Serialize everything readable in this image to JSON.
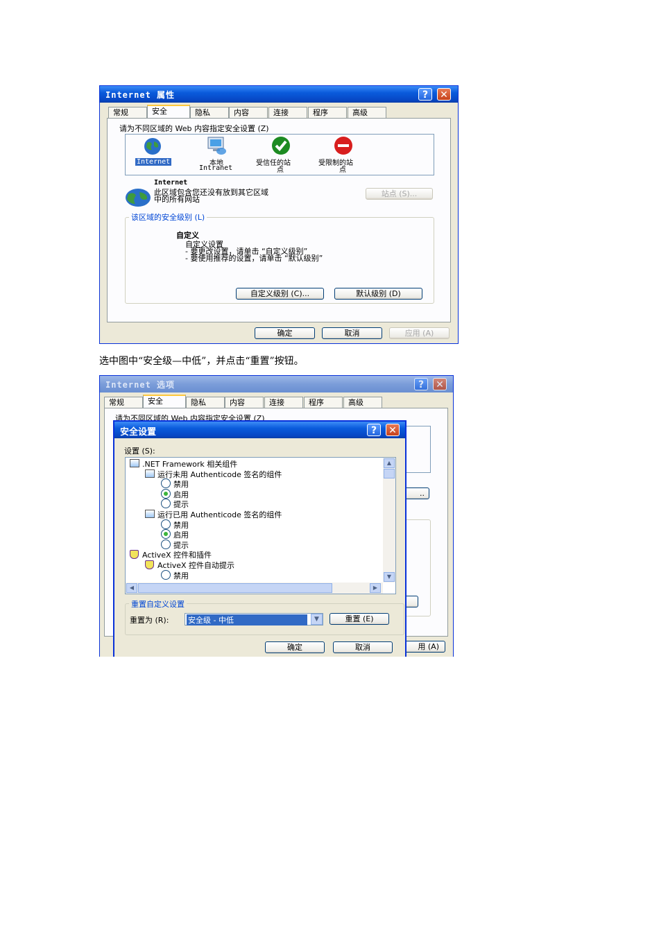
{
  "window1": {
    "title": "Internet 属性",
    "tabs": [
      "常规",
      "安全",
      "隐私",
      "内容",
      "连接",
      "程序",
      "高级"
    ],
    "zone_instruction": "请为不同区域的 Web 内容指定安全设置 (Z)",
    "zones": [
      {
        "line1": "Internet",
        "line2": ""
      },
      {
        "line1": "本地",
        "line2": "Intranet"
      },
      {
        "line1": "受信任的站",
        "line2": "点"
      },
      {
        "line1": "受限制的站",
        "line2": "点"
      }
    ],
    "zone_title": "Internet",
    "zone_desc_line1": "此区域包含您还没有放到其它区域",
    "zone_desc_line2": "中的所有网站",
    "sites_button": "站点 (S)...",
    "security_level_legend": "该区域的安全级别 (L)",
    "level_name": "自定义",
    "level_line1": "自定义设置",
    "level_line2": "- 要更改设置，请单击 “自定义级别”",
    "level_line3": "- 要使用推荐的设置，请单击 “默认级别”",
    "custom_level_button": "自定义级别 (C)...",
    "default_level_button": "默认级别 (D)",
    "ok_button": "确定",
    "cancel_button": "取消",
    "apply_button": "应用 (A)"
  },
  "caption": "选中图中“安全级—中低”，并点击“重置”按钮。",
  "window2": {
    "title": "Internet 选项",
    "tabs": [
      "常规",
      "安全",
      "隐私",
      "内容",
      "连接",
      "程序",
      "高级"
    ],
    "zone_instruction_partial": "请为不同区域的 Web 内容指定安全设置 (Z)",
    "sites_button_partial": "..",
    "apply_button_partial": "用 (A)"
  },
  "dialog": {
    "title": "安全设置",
    "settings_label": "设置 (S):",
    "tree": [
      {
        "level": 0,
        "icon": "net-framework-icon",
        "text": ".NET Framework 相关组件"
      },
      {
        "level": 1,
        "icon": "net-framework-icon",
        "text": "运行未用 Authenticode 签名的组件"
      },
      {
        "level": 2,
        "radio": false,
        "text": "禁用"
      },
      {
        "level": 2,
        "radio": true,
        "text": "启用"
      },
      {
        "level": 2,
        "radio": false,
        "text": "提示"
      },
      {
        "level": 1,
        "icon": "net-framework-icon",
        "text": "运行已用 Authenticode 签名的组件"
      },
      {
        "level": 2,
        "radio": false,
        "text": "禁用"
      },
      {
        "level": 2,
        "radio": true,
        "text": "启用"
      },
      {
        "level": 2,
        "radio": false,
        "text": "提示"
      },
      {
        "level": 0,
        "icon": "activex-shield-icon",
        "text": "ActiveX 控件和插件"
      },
      {
        "level": 1,
        "icon": "activex-shield-icon",
        "text": "ActiveX 控件自动提示"
      },
      {
        "level": 2,
        "radio": false,
        "text": "禁用"
      }
    ],
    "reset_group_legend": "重置自定义设置",
    "reset_to_label": "重置为 (R):",
    "reset_select_value": "安全级 - 中低",
    "reset_button": "重置 (E)",
    "ok_button": "确定",
    "cancel_button": "取消"
  }
}
